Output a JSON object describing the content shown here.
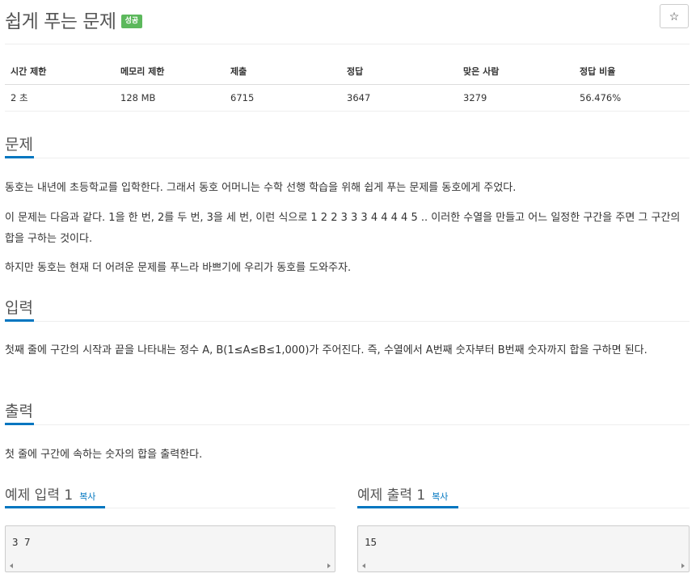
{
  "header": {
    "title": "쉽게 푸는 문제",
    "badge": "성공",
    "star_icon": "star-icon",
    "star_glyph": "☆"
  },
  "stats": {
    "headers": [
      "시간 제한",
      "메모리 제한",
      "제출",
      "정답",
      "맞은 사람",
      "정답 비율"
    ],
    "values": [
      "2 초",
      "128 MB",
      "6715",
      "3647",
      "3279",
      "56.476%"
    ]
  },
  "problem": {
    "heading": "문제",
    "p1": "동호는 내년에 초등학교를 입학한다. 그래서 동호 어머니는 수학 선행 학습을 위해 쉽게 푸는 문제를 동호에게 주었다.",
    "p2": "이 문제는 다음과 같다. 1을 한 번, 2를 두 번, 3을 세 번, 이런 식으로 1 2 2 3 3 3 4 4 4 4 5 .. 이러한 수열을 만들고 어느 일정한 구간을 주면 그 구간의 합을 구하는 것이다.",
    "p3": "하지만 동호는 현재 더 어려운 문제를 푸느라 바쁘기에 우리가 동호를 도와주자."
  },
  "input": {
    "heading": "입력",
    "p1": "첫째 줄에 구간의 시작과 끝을 나타내는 정수 A, B(1≤A≤B≤1,000)가 주어진다. 즉, 수열에서 A번째 숫자부터 B번째 숫자까지 합을 구하면 된다."
  },
  "output": {
    "heading": "출력",
    "p1": "첫 줄에 구간에 속하는 숫자의 합을 출력한다."
  },
  "samples": {
    "input_title": "예제 입력 1",
    "output_title": "예제 출력 1",
    "copy_label": "복사",
    "input_value": "3 7",
    "output_value": "15"
  },
  "colors": {
    "accent": "#0076c0",
    "badge": "#5cb85c"
  }
}
